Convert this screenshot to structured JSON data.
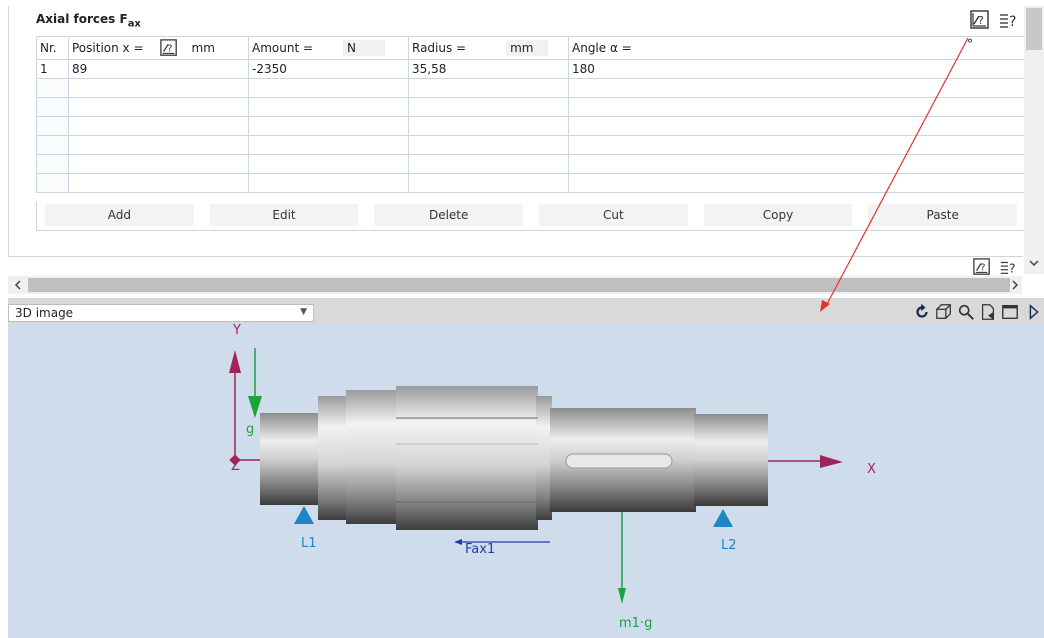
{
  "section": {
    "title": "Axial forces F",
    "title_sub": "ax"
  },
  "table": {
    "headers": {
      "nr": "Nr.",
      "position": "Position x =",
      "position_unit": "mm",
      "amount": "Amount =",
      "amount_unit": "N",
      "radius": "Radius =",
      "radius_unit": "mm",
      "angle": "Angle α =",
      "angle_unit": "°"
    },
    "rows": [
      {
        "nr": "1",
        "position": "89",
        "amount": "-2350",
        "radius": "35,58",
        "angle": "180"
      }
    ]
  },
  "buttons": {
    "add": "Add",
    "edit": "Edit",
    "delete": "Delete",
    "cut": "Cut",
    "copy": "Copy",
    "paste": "Paste"
  },
  "view": {
    "select_value": "3D image"
  },
  "scene": {
    "axis_y": "Y",
    "axis_x": "X",
    "axis_z": "Z",
    "gravity": "g",
    "bearing_left": "L1",
    "bearing_right": "L2",
    "force": "Fax1",
    "weight": "m1·g"
  },
  "colors": {
    "axis": "#a0245a",
    "gravity": "#1aa53a",
    "bearing": "#1f86c4",
    "force": "#1f3fa8",
    "annotation_arrow": "#e53030",
    "viewport_bg": "#cfdcec"
  }
}
